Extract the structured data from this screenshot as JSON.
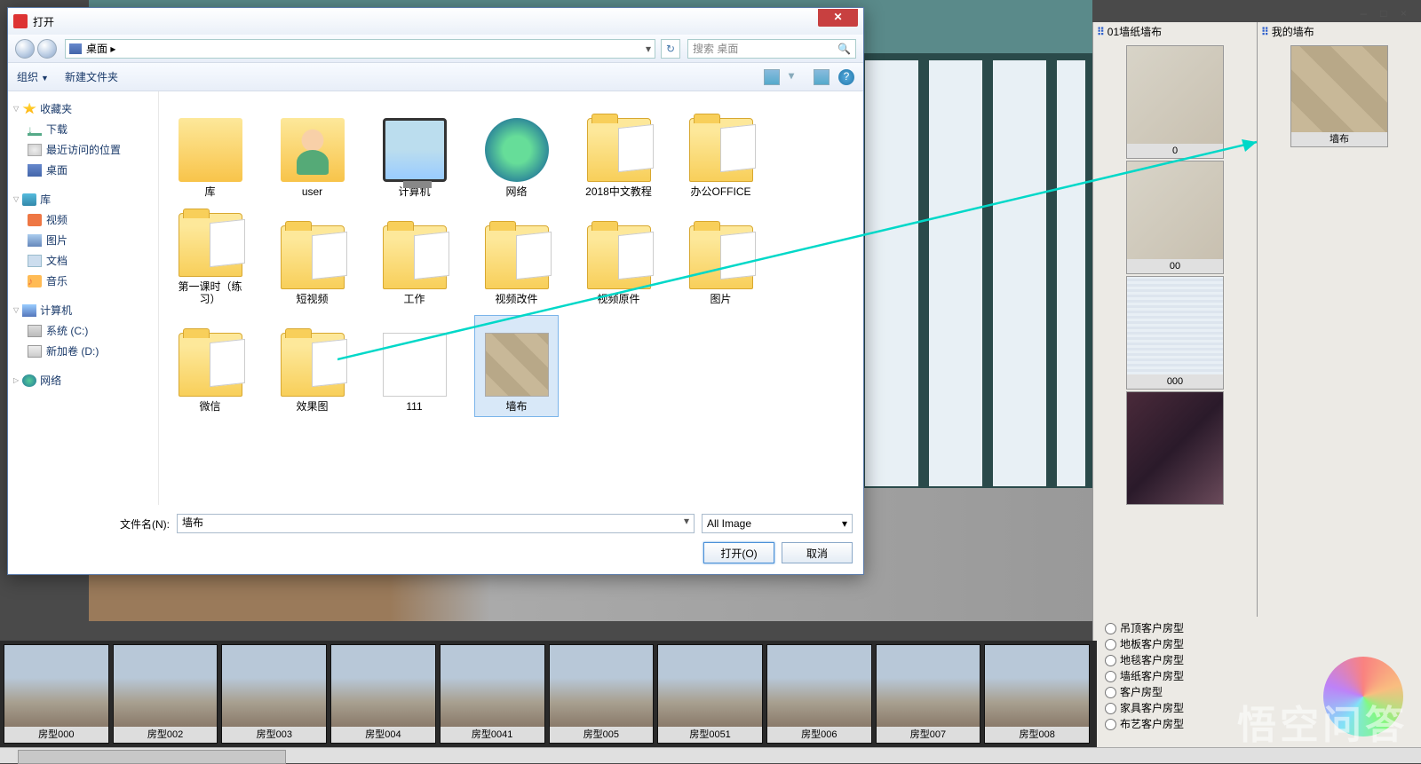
{
  "app": {
    "title": "打开"
  },
  "app_window_ctrls": {
    "min": "—",
    "max": "□",
    "close": "×"
  },
  "dialog": {
    "title": "打开",
    "close": "✕",
    "location_icon_alt": "desktop",
    "location": "桌面",
    "dropdown": "▾",
    "refresh": "↻",
    "search_placeholder": "搜索 桌面",
    "search_icon": "🔍",
    "toolbar": {
      "organize": "组织",
      "newfolder": "新建文件夹"
    },
    "help": "?",
    "nav": {
      "favorites": "收藏夹",
      "fav_items": [
        "下载",
        "最近访问的位置",
        "桌面"
      ],
      "libraries": "库",
      "lib_items": [
        "视频",
        "图片",
        "文档",
        "音乐"
      ],
      "computer": "计算机",
      "drives": [
        "系统 (C:)",
        "新加卷 (D:)"
      ],
      "network": "网络"
    },
    "files": [
      {
        "label": "库",
        "icon": "lib"
      },
      {
        "label": "user",
        "icon": "user"
      },
      {
        "label": "计算机",
        "icon": "comp"
      },
      {
        "label": "网络",
        "icon": "net"
      },
      {
        "label": "2018中文教程",
        "icon": "folder-f"
      },
      {
        "label": "办公OFFICE",
        "icon": "folder-f"
      },
      {
        "label": "第一课时（练习）",
        "icon": "folder-f"
      },
      {
        "label": "短视频",
        "icon": "folder-f"
      },
      {
        "label": "工作",
        "icon": "folder-f"
      },
      {
        "label": "视频改件",
        "icon": "folder-f"
      },
      {
        "label": "视频原件",
        "icon": "folder-f"
      },
      {
        "label": "图片",
        "icon": "folder-f"
      },
      {
        "label": "微信",
        "icon": "folder-f"
      },
      {
        "label": "效果图",
        "icon": "folder-f"
      },
      {
        "label": "111",
        "icon": "doc"
      },
      {
        "label": "墙布",
        "icon": "img",
        "selected": true
      }
    ],
    "filename_label": "文件名(N):",
    "filename_value": "墙布",
    "filetype": "All Image",
    "open_btn": "打开(O)",
    "cancel_btn": "取消"
  },
  "rightpanel": {
    "col1_title": "01墙纸墙布",
    "col2_title": "我的墙布",
    "featured_label": "墙布",
    "swatches": [
      "0",
      "00",
      "000"
    ]
  },
  "categories": [
    "吊顶客户房型",
    "地板客户房型",
    "地毯客户房型",
    "墙纸客户房型",
    "客户房型",
    "家具客户房型",
    "布艺客户房型"
  ],
  "thumbs": [
    "房型000",
    "房型002",
    "房型003",
    "房型004",
    "房型0041",
    "房型005",
    "房型0051",
    "房型006",
    "房型007",
    "房型008"
  ],
  "watermark": "悟空问答"
}
